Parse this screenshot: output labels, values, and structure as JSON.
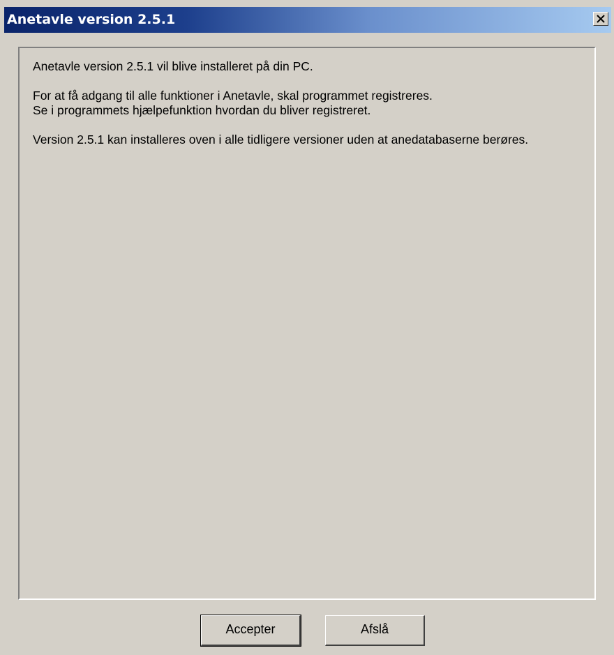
{
  "window": {
    "title": "Anetavle version 2.5.1"
  },
  "message": {
    "line1": "Anetavle version 2.5.1 vil blive installeret på din PC.",
    "line2a": "For at få adgang til alle funktioner i Anetavle, skal programmet registreres.",
    "line2b": "Se i programmets hjælpefunktion hvordan du bliver registreret.",
    "line3": "Version 2.5.1 kan installeres oven i alle tidligere versioner uden at anedatabaserne berøres."
  },
  "buttons": {
    "accept_label": "Accepter",
    "decline_label": "Afslå"
  },
  "colors": {
    "dialog_bg": "#d4d0c8",
    "titlebar_start": "#0a246a",
    "titlebar_end": "#a6caf0"
  },
  "icons": {
    "close": "close-icon"
  }
}
